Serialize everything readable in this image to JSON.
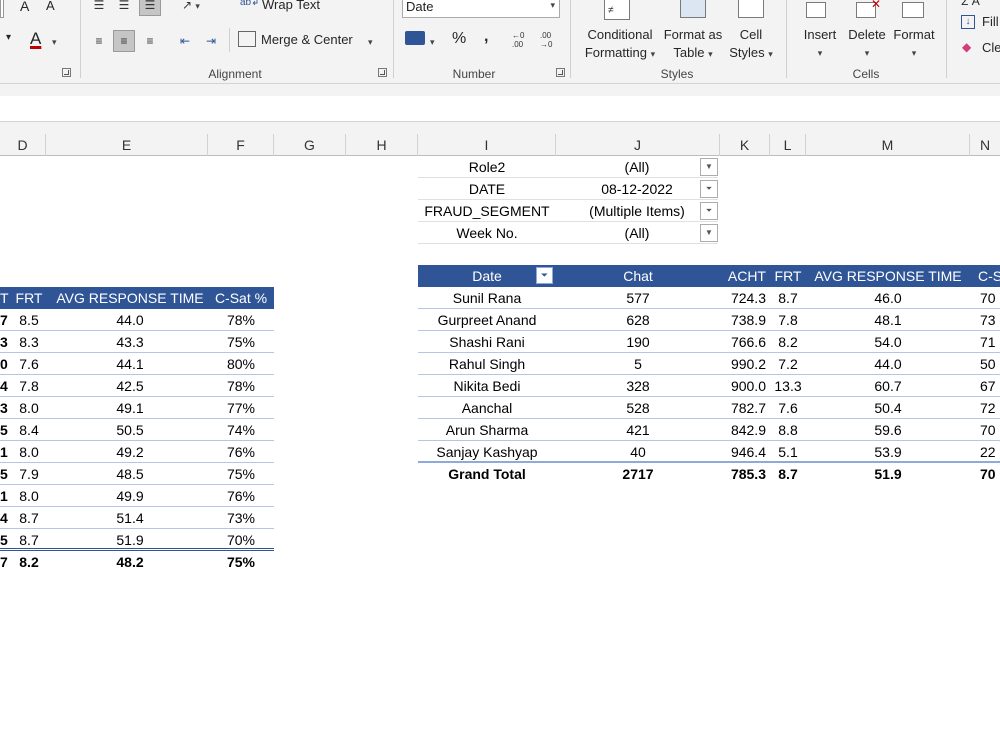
{
  "ribbon": {
    "font_row1": [
      "A",
      "A"
    ],
    "font_color_letter": "A",
    "wrap_text": "Wrap Text",
    "merge_center": "Merge & Center",
    "number_format": "Date",
    "percent": "%",
    "comma": ",",
    "conditional_formatting": [
      "Conditional",
      "Formatting"
    ],
    "format_as_table": [
      "Format as",
      "Table"
    ],
    "cell_styles": [
      "Cell",
      "Styles"
    ],
    "insert": "Insert",
    "delete": "Delete",
    "format": "Format",
    "fill": "Fill",
    "clear": "Cle",
    "groups": {
      "alignment": "Alignment",
      "number": "Number",
      "styles": "Styles",
      "cells": "Cells"
    }
  },
  "columns": [
    "D",
    "E",
    "F",
    "G",
    "H",
    "I",
    "J",
    "K",
    "L",
    "M",
    "N"
  ],
  "left_table": {
    "headers": [
      "T",
      "FRT",
      "AVG RESPONSE TIME",
      "C-Sat %"
    ],
    "rows": [
      {
        "c": "7",
        "frt": "8.5",
        "art": "44.0",
        "csat": "78%"
      },
      {
        "c": "3",
        "frt": "8.3",
        "art": "43.3",
        "csat": "75%"
      },
      {
        "c": "0",
        "frt": "7.6",
        "art": "44.1",
        "csat": "80%"
      },
      {
        "c": "4",
        "frt": "7.8",
        "art": "42.5",
        "csat": "78%"
      },
      {
        "c": "3",
        "frt": "8.0",
        "art": "49.1",
        "csat": "77%"
      },
      {
        "c": "5",
        "frt": "8.4",
        "art": "50.5",
        "csat": "74%"
      },
      {
        "c": "1",
        "frt": "8.0",
        "art": "49.2",
        "csat": "76%"
      },
      {
        "c": "5",
        "frt": "7.9",
        "art": "48.5",
        "csat": "75%"
      },
      {
        "c": "1",
        "frt": "8.0",
        "art": "49.9",
        "csat": "76%"
      },
      {
        "c": "4",
        "frt": "8.7",
        "art": "51.4",
        "csat": "73%"
      },
      {
        "c": "5",
        "frt": "8.7",
        "art": "51.9",
        "csat": "70%"
      }
    ],
    "total": {
      "c": "7",
      "frt": "8.2",
      "art": "48.2",
      "csat": "75%"
    }
  },
  "filters": [
    {
      "label": "Role2",
      "value": "(All)",
      "filtered": false
    },
    {
      "label": "DATE",
      "value": "08-12-2022",
      "filtered": true
    },
    {
      "label": "FRAUD_SEGMENT",
      "value": "(Multiple Items)",
      "filtered": true
    },
    {
      "label": "Week No.",
      "value": "(All)",
      "filtered": false
    }
  ],
  "pivot": {
    "headers": [
      "Date",
      "Chat",
      "ACHT",
      "FRT",
      "AVG RESPONSE TIME",
      "C-S"
    ],
    "rows": [
      {
        "name": "Sunil Rana",
        "chat": "577",
        "acht": "724.3",
        "frt": "8.7",
        "art": "46.0",
        "csat": "70"
      },
      {
        "name": "Gurpreet Anand",
        "chat": "628",
        "acht": "738.9",
        "frt": "7.8",
        "art": "48.1",
        "csat": "73"
      },
      {
        "name": "Shashi Rani",
        "chat": "190",
        "acht": "766.6",
        "frt": "8.2",
        "art": "54.0",
        "csat": "71"
      },
      {
        "name": "Rahul Singh",
        "chat": "5",
        "acht": "990.2",
        "frt": "7.2",
        "art": "44.0",
        "csat": "50"
      },
      {
        "name": "Nikita Bedi",
        "chat": "328",
        "acht": "900.0",
        "frt": "13.3",
        "art": "60.7",
        "csat": "67"
      },
      {
        "name": "Aanchal",
        "chat": "528",
        "acht": "782.7",
        "frt": "7.6",
        "art": "50.4",
        "csat": "72"
      },
      {
        "name": "Arun Sharma",
        "chat": "421",
        "acht": "842.9",
        "frt": "8.8",
        "art": "59.6",
        "csat": "70"
      },
      {
        "name": "Sanjay Kashyap",
        "chat": "40",
        "acht": "946.4",
        "frt": "5.1",
        "art": "53.9",
        "csat": "22"
      }
    ],
    "total": {
      "name": "Grand Total",
      "chat": "2717",
      "acht": "785.3",
      "frt": "8.7",
      "art": "51.9",
      "csat": "70"
    }
  },
  "colors": {
    "header_fill": "#2f5597",
    "row_line": "#b4c6e7",
    "ribbon_bg": "#f3f3f3"
  }
}
